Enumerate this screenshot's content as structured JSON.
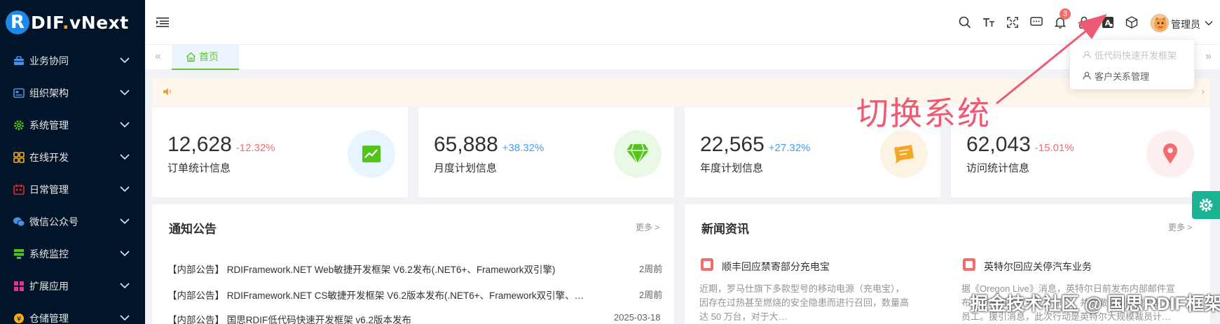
{
  "app": {
    "logo_r": "R",
    "logo_text_a": "DIF",
    "logo_dot": ".",
    "logo_text_b": "vNext"
  },
  "sidebar": {
    "items": [
      {
        "label": "业务协同",
        "icon": "briefcase-icon",
        "color": "#4a90e2"
      },
      {
        "label": "组织架构",
        "icon": "org-chart-icon",
        "color": "#4a90e2"
      },
      {
        "label": "系统管理",
        "icon": "gear-icon",
        "color": "#52c41a"
      },
      {
        "label": "在线开发",
        "icon": "grid-icon",
        "color": "#faad14"
      },
      {
        "label": "日常管理",
        "icon": "calendar-icon",
        "color": "#f5222d"
      },
      {
        "label": "微信公众号",
        "icon": "wechat-icon",
        "color": "#4a90e2"
      },
      {
        "label": "系统监控",
        "icon": "monitor-icon",
        "color": "#52c41a"
      },
      {
        "label": "扩展应用",
        "icon": "apps-icon",
        "color": "#eb2f96"
      },
      {
        "label": "仓储管理",
        "icon": "warehouse-icon",
        "color": "#faad14"
      }
    ]
  },
  "header": {
    "notification_count": "3",
    "user_name": "管理员"
  },
  "tabs": {
    "scroll_left": "«",
    "scroll_right": "»",
    "home_label": "首页"
  },
  "notice_bar": {
    "arrow": "›"
  },
  "stats": [
    {
      "value": "12,628",
      "change": "-12.32%",
      "change_color": "#f56c6c",
      "label": "订单统计信息",
      "icon": "trend-chart-icon",
      "icon_bg": "#e8f4ff",
      "icon_color": "#52c41a"
    },
    {
      "value": "65,888",
      "change": "+38.32%",
      "change_color": "#409eff",
      "label": "月度计划信息",
      "icon": "diamond-icon",
      "icon_bg": "#eaf8e6",
      "icon_color": "#52c41a"
    },
    {
      "value": "22,565",
      "change": "+27.32%",
      "change_color": "#409eff",
      "label": "年度计划信息",
      "icon": "message-icon",
      "icon_bg": "#fdf3e3",
      "icon_color": "#f5a623"
    },
    {
      "value": "62,043",
      "change": "-15.01%",
      "change_color": "#f56c6c",
      "label": "访问统计信息",
      "icon": "location-pin-icon",
      "icon_bg": "#fdeef0",
      "icon_color": "#f56c6c"
    }
  ],
  "notices": {
    "title": "通知公告",
    "more": "更多 >",
    "items": [
      {
        "text": "【内部公告】 RDIFramework.NET Web敏捷开发框架 V6.2发布(.NET6+、Framework双引擎)",
        "date": "2周前"
      },
      {
        "text": "【内部公告】 RDIFramework.NET CS敏捷开发框架 V6.2版本发布(.NET6+、Framework双引擎、…",
        "date": "2周前"
      },
      {
        "text": "【内部公告】 国思RDIF低代码快速开发框架 v6.2版本发布",
        "date": "2025-03-18"
      }
    ]
  },
  "news": {
    "title": "新闻资讯",
    "more": "更多 >",
    "items": [
      {
        "title": "顺丰回应禁寄部分充电宝",
        "body_lines": [
          "近期，罗马仕旗下多款型号的移动电源（充电宝），",
          "因存在过热甚至燃烧的安全隐患而进行召回，数量高",
          "达 50 万台，对于大…"
        ]
      },
      {
        "title": "英特尔回应关停汽车业务",
        "body_lines": [
          "据《Oregon Live》消息，英特尔日前发布内部邮件宣",
          "布，将关闭其汽车业务部门，并裁撤该部门的大部分",
          "员工。援引消息，此次行动是英特尔大规模裁员计…"
        ]
      }
    ]
  },
  "system_dropdown": {
    "items": [
      {
        "label": "低代码快速开发框架",
        "state": "current"
      },
      {
        "label": "客户关系管理",
        "state": "normal"
      }
    ]
  },
  "annotation": {
    "text": "切换系统",
    "color": "#ef5a73"
  },
  "watermark": "掘金技术社区 @ 国思RDIF框架"
}
